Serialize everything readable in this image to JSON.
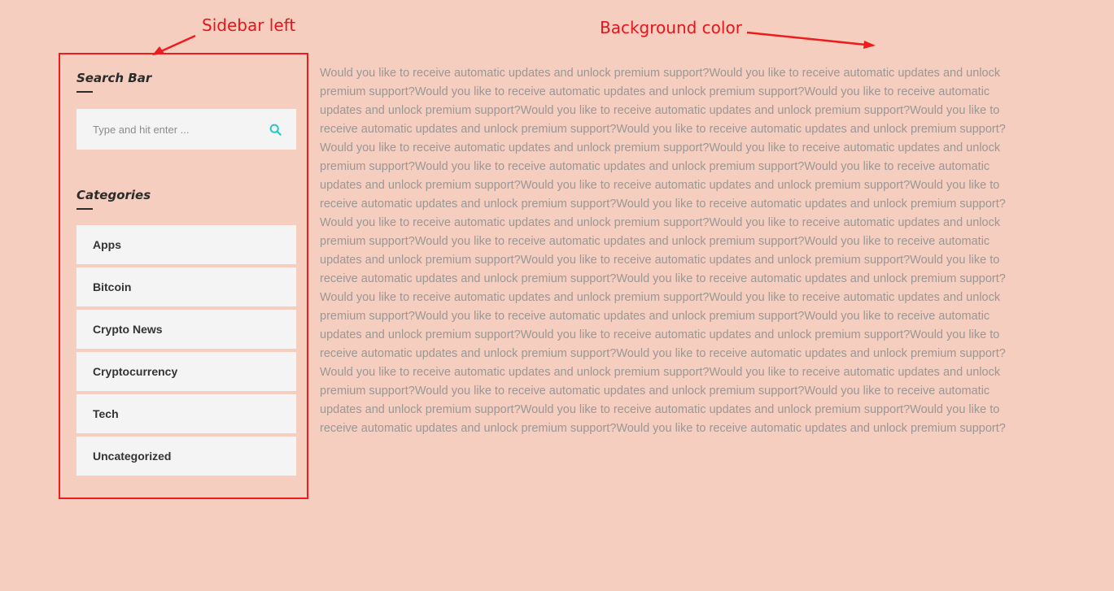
{
  "colors": {
    "page_background": "#f5cec0",
    "annotation_red": "#e8141b",
    "widget_background": "#f4f4f4",
    "search_icon": "#2ec4c4",
    "body_text": "#9a9794",
    "title_text": "#2b2b2b"
  },
  "annotations": {
    "sidebar_label": "Sidebar left",
    "background_label": "Background color"
  },
  "sidebar": {
    "search": {
      "title": "Search Bar",
      "placeholder": "Type and hit enter ...",
      "icon": "search-icon"
    },
    "categories": {
      "title": "Categories",
      "items": [
        {
          "label": "Apps"
        },
        {
          "label": "Bitcoin"
        },
        {
          "label": "Crypto News"
        },
        {
          "label": "Cryptocurrency"
        },
        {
          "label": "Tech"
        },
        {
          "label": "Uncategorized"
        }
      ]
    }
  },
  "main": {
    "body_text": "Would you like to receive automatic updates and unlock premium support?Would you like to receive automatic updates and unlock premium support?Would you like to receive automatic updates and unlock premium support?Would you like to receive automatic updates and unlock premium support?Would you like to receive automatic updates and unlock premium support?Would you like to receive automatic updates and unlock premium support?Would you like to receive automatic updates and unlock premium support?Would you like to receive automatic updates and unlock premium support?Would you like to receive automatic updates and unlock premium support?Would you like to receive automatic updates and unlock premium support?Would you like to receive automatic updates and unlock premium support?Would you like to receive automatic updates and unlock premium support?Would you like to receive automatic updates and unlock premium support?Would you like to receive automatic updates and unlock premium support?Would you like to receive automatic updates and unlock premium support?Would you like to receive automatic updates and unlock premium support?Would you like to receive automatic updates and unlock premium support?Would you like to receive automatic updates and unlock premium support?Would you like to receive automatic updates and unlock premium support?Would you like to receive automatic updates and unlock premium support?Would you like to receive automatic updates and unlock premium support?Would you like to receive automatic updates and unlock premium support?Would you like to receive automatic updates and unlock premium support?Would you like to receive automatic updates and unlock premium support?Would you like to receive automatic updates and unlock premium support?Would you like to receive automatic updates and unlock premium support?Would you like to receive automatic updates and unlock premium support?Would you like to receive automatic updates and unlock premium support?Would you like to receive automatic updates and unlock premium support?Would you like to receive automatic updates and unlock premium support?Would you like to receive automatic updates and unlock premium support?Would you like to receive automatic updates and unlock premium support?Would you like to receive automatic updates and unlock premium support?Would you like to receive automatic updates and unlock premium support?Would you like to receive automatic updates and unlock premium support?"
  }
}
